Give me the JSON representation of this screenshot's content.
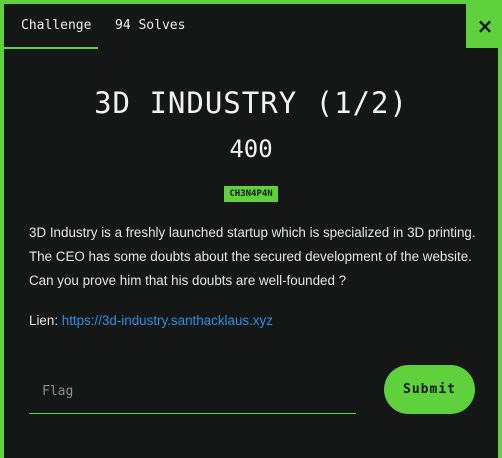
{
  "tabs": [
    {
      "label": "Challenge",
      "active": true
    },
    {
      "label": "94 Solves",
      "active": false
    }
  ],
  "close_label": "×",
  "challenge": {
    "title": "3D INDUSTRY (1/2)",
    "points": "400",
    "author_tag": "CH3N4P4N",
    "description": "3D Industry is a freshly launched startup which is specialized in 3D printing. The CEO has some doubts about the secured development of the website. Can you prove him that his doubts are well-founded ?",
    "link_label": "Lien: ",
    "link_text": "https://3d-industry.santhacklaus.xyz"
  },
  "form": {
    "flag_placeholder": "Flag",
    "flag_value": "",
    "submit_label": "Submit"
  },
  "colors": {
    "accent": "#5fd13c",
    "background": "#151616",
    "link": "#2f8fe6"
  }
}
